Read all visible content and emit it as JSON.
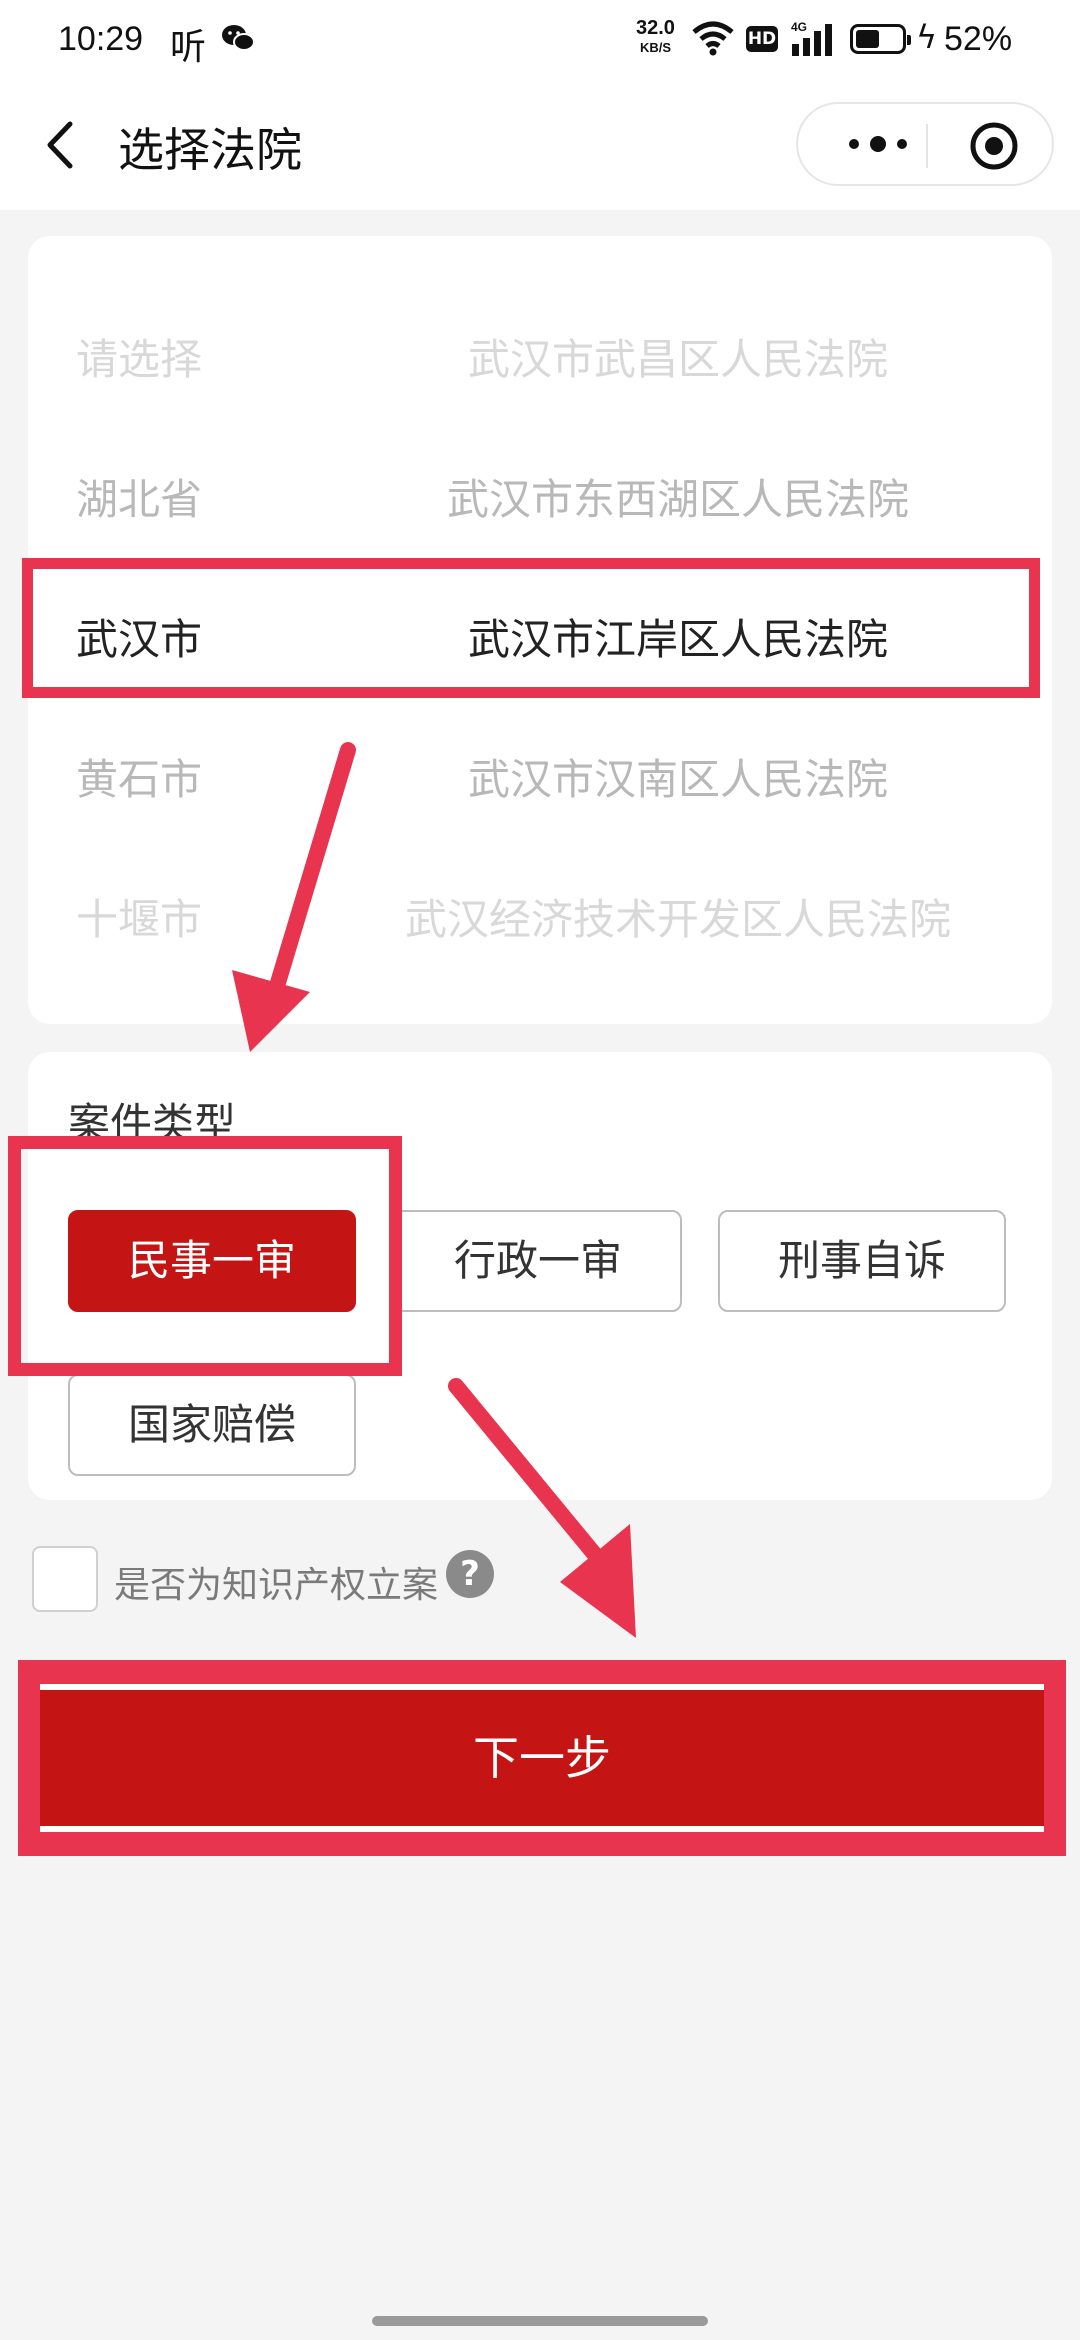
{
  "status_bar": {
    "time": "10:29",
    "listen_icon_text": "听",
    "net_speed_value": "32.0",
    "net_speed_unit": "KB/S",
    "hd_badge": "HD",
    "network": "4G",
    "battery_percent": "52%",
    "battery_level": 0.52
  },
  "nav": {
    "title": "选择法院",
    "icons": [
      "back-arrow-icon",
      "more-dots-icon",
      "target-icon"
    ]
  },
  "picker": {
    "rows": [
      {
        "province": "请选择",
        "court": "武汉市武昌区人民法院",
        "state": "faint"
      },
      {
        "province": "湖北省",
        "court": "武汉市东西湖区人民法院",
        "state": "mid"
      },
      {
        "province": "武汉市",
        "court": "武汉市江岸区人民法院",
        "state": "selected"
      },
      {
        "province": "黄石市",
        "court": "武汉市汉南区人民法院",
        "state": "mid"
      },
      {
        "province": "十堰市",
        "court": "武汉经济技术开发区人民法院",
        "state": "faint"
      }
    ]
  },
  "case_type": {
    "title": "案件类型",
    "options": [
      {
        "label": "民事一审",
        "selected": true
      },
      {
        "label": "行政一审",
        "selected": false
      },
      {
        "label": "刑事自诉",
        "selected": false
      },
      {
        "label": "国家赔偿",
        "selected": false
      }
    ]
  },
  "ip_filing": {
    "label": "是否为知识产权立案",
    "checked": false,
    "help_icon": "?"
  },
  "next_button": {
    "label": "下一步"
  },
  "colors": {
    "brand_red": "#c51414",
    "annotation_red": "#e8344e"
  }
}
